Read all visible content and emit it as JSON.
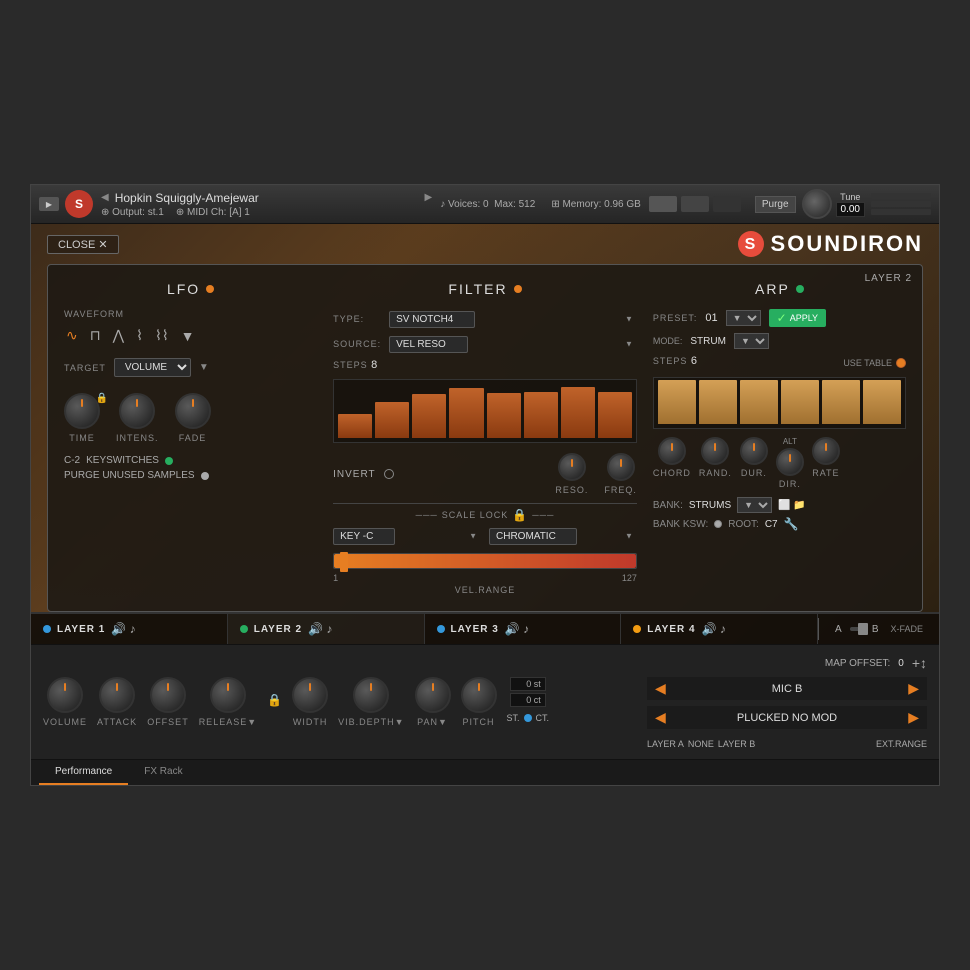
{
  "header": {
    "instrument_name": "Hopkin Squiggly-Amejewar",
    "output": "st.1",
    "midi_ch": "[A] 1",
    "voices": "0",
    "max_voices": "512",
    "memory": "0.96 GB",
    "tune_label": "Tune",
    "tune_value": "0.00",
    "purge_label": "Purge"
  },
  "ui": {
    "close_label": "CLOSE",
    "logo": "SOUNDIRON",
    "layer_badge": "LAYER 2"
  },
  "lfo": {
    "title": "LFO",
    "waveform_label": "WAVEFORM",
    "target_label": "TARGET",
    "target_value": "VOLUME",
    "time_label": "TIME",
    "intens_label": "INTENS.",
    "fade_label": "FADE",
    "keyswitch_note": "C-2",
    "keyswitch_label": "KEYSWITCHES",
    "purge_label": "PURGE UNUSED SAMPLES"
  },
  "filter": {
    "title": "FILTER",
    "type_label": "TYPE:",
    "type_value": "SV NOTCH4",
    "source_label": "SOURCE:",
    "source_value": "VEL RESO",
    "steps_label": "STEPS",
    "steps_value": "8",
    "invert_label": "INVERT",
    "reso_label": "RESO.",
    "freq_label": "FREQ.",
    "scale_lock_label": "SCALE LOCK",
    "key_label": "KEY -C",
    "chromatic_label": "CHROMATIC",
    "vel_range_min": "1",
    "vel_range_max": "127",
    "vel_range_label": "VEL.RANGE",
    "bars": [
      30,
      45,
      55,
      62,
      56,
      58,
      64,
      58
    ]
  },
  "arp": {
    "title": "ARP",
    "preset_label": "PRESET:",
    "preset_value": "01",
    "apply_label": "APPLY",
    "mode_label": "MODE:",
    "mode_value": "STRUM",
    "steps_label": "STEPS",
    "steps_value": "6",
    "use_table_label": "USE TABLE",
    "chord_label": "CHORD",
    "rand_label": "RAND.",
    "dur_label": "DUR.",
    "dir_label": "DIR.",
    "rate_label": "RATE",
    "alt_label": "ALT",
    "bank_label": "BANK:",
    "bank_value": "STRUMS",
    "bank_ksw_label": "BANK KSW:",
    "root_label": "ROOT:",
    "root_value": "C7",
    "ext_range_label": "EXT.RANGE",
    "bars": [
      52,
      52,
      52,
      52,
      52,
      52
    ]
  },
  "layers": [
    {
      "name": "LAYER 1",
      "color": "#3498db",
      "active": false
    },
    {
      "name": "LAYER 2",
      "color": "#27ae60",
      "active": true
    },
    {
      "name": "LAYER 3",
      "color": "#3498db",
      "active": false
    },
    {
      "name": "LAYER 4",
      "color": "#f39c12",
      "active": false
    }
  ],
  "xfade": {
    "a_label": "A",
    "b_label": "B",
    "label": "X-FADE"
  },
  "bottom_controls": {
    "volume_label": "VOLUME",
    "attack_label": "ATTACK",
    "offset_label": "OFFSET",
    "release_label": "RELEASE",
    "width_label": "WIDTH",
    "vib_depth_label": "VIB.DEPTH",
    "pan_label": "PAN",
    "pitch_label": "PITCH",
    "pitch_st": "0 st",
    "pitch_ct": "0 ct",
    "st_label": "ST.",
    "ct_label": "CT.",
    "map_offset_label": "MAP OFFSET:",
    "map_offset_value": "0",
    "mic_b_label": "MIC B",
    "plucked_no_mod_label": "PLUCKED NO MOD",
    "layer_a_label": "LAYER A",
    "none_label": "NONE",
    "layer_b_label": "LAYER B",
    "ext_range_label": "EXT.RANGE"
  },
  "bottom_tabs": [
    {
      "label": "Performance",
      "active": true
    },
    {
      "label": "FX Rack",
      "active": false
    }
  ]
}
